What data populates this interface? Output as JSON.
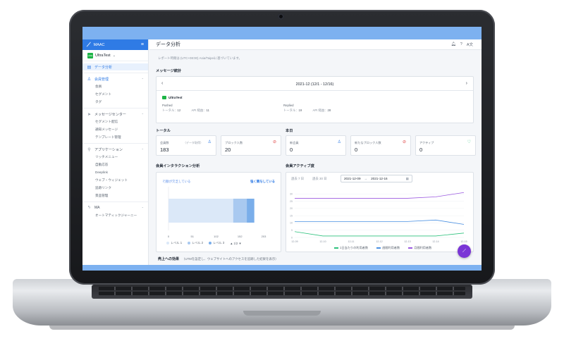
{
  "app": {
    "brand": "MAAC",
    "org": "UltraTest",
    "page_title": "データ分析",
    "line_badge": "LINE"
  },
  "sidebar": {
    "items": [
      {
        "label": "データ分析",
        "icon": "chart-icon",
        "active": true
      },
      {
        "label": "会員管理",
        "icon": "user-icon",
        "group": true
      },
      {
        "label": "会員",
        "sub": true
      },
      {
        "label": "セグメント",
        "sub": true
      },
      {
        "label": "タグ",
        "sub": true
      },
      {
        "label": "メッセージセンター",
        "icon": "send-icon",
        "group": true
      },
      {
        "label": "セグメント配信",
        "sub": true
      },
      {
        "label": "通知メッセージ",
        "sub": true
      },
      {
        "label": "テンプレート管理",
        "sub": true
      },
      {
        "label": "アプリケーション",
        "icon": "rocket-icon",
        "group": true
      },
      {
        "label": "リッチメニュー",
        "sub": true
      },
      {
        "label": "自動応答",
        "sub": true
      },
      {
        "label": "Deeplink",
        "sub": true
      },
      {
        "label": "ウェブ・ウィジェット",
        "sub": true
      },
      {
        "label": "追跡リンク",
        "sub": true
      },
      {
        "label": "景品管理",
        "sub": true
      },
      {
        "label": "MA",
        "icon": "bolt-icon",
        "group": true
      },
      {
        "label": "オートマティックジャーニー",
        "sub": true
      }
    ]
  },
  "main": {
    "timezone_note": "レポート時間は (UTC+08:00) Asia/Taipeiに基づいています。",
    "message_stats": {
      "title": "メッセージ統計",
      "range": "2021-12 (12/1 - 12/16)",
      "account": "UltraTest",
      "pushed": {
        "label": "Pushed",
        "total_label": "トータル：",
        "total": "12",
        "api_label": "API 経由：",
        "api": "11"
      },
      "replied": {
        "label": "Replied",
        "total_label": "トータル：",
        "total": "19",
        "api_label": "API 経由：",
        "api": "28"
      }
    },
    "total": {
      "title": "トータル",
      "cards": [
        {
          "label": "会員数",
          "sub": "（データ取得）",
          "value": "183",
          "icon": "user-icon",
          "color": "#2f7be5"
        },
        {
          "label": "ブロック人数",
          "value": "20",
          "icon": "block-icon",
          "color": "#e04848"
        }
      ]
    },
    "today": {
      "title": "本日",
      "cards": [
        {
          "label": "新会員",
          "value": "0",
          "icon": "user-icon",
          "color": "#2f7be5"
        },
        {
          "label": "新たなブロック人数",
          "value": "0",
          "icon": "block-icon",
          "color": "#e04848"
        },
        {
          "label": "アクティブ",
          "value": "0",
          "icon": "heart-icon",
          "color": "#2ec27e"
        }
      ]
    },
    "interaction": {
      "title": "会員インタラクション分析",
      "left_tag": "行動が欠乏している",
      "right_tag": "強く関与している",
      "legend": [
        "レベル 1",
        "レベル 2",
        "レベル 3"
      ],
      "pager": "1/2",
      "axis_ticks": [
        "0",
        "51",
        "102",
        "152",
        "203"
      ]
    },
    "activity": {
      "title": "会員アクティブ度",
      "btn_7": "過去 7 日",
      "btn_30": "過去 30 日",
      "date_from": "2021-12-09",
      "date_to": "2021-12-16",
      "date_sep": "→",
      "legend": [
        "1日当たりの利用者数",
        "週間利用者数",
        "月間利用者数"
      ]
    },
    "impact": {
      "title": "売上への効果",
      "note": "（UTMを設定し、ウェブサイトへのアクセスを追跡した結果を表示）"
    }
  },
  "chart_data": [
    {
      "type": "bar",
      "title": "会員インタラクション分析",
      "categories": [
        "レベル 1",
        "レベル 2",
        "レベル 3"
      ],
      "series": [
        {
          "name": "レベル 1",
          "values": [
            138
          ]
        },
        {
          "name": "レベル 2",
          "values": [
            29
          ]
        },
        {
          "name": "レベル 3",
          "values": [
            16
          ]
        }
      ],
      "stacked": true,
      "orientation": "horizontal",
      "xlim": [
        0,
        203
      ],
      "xticks": [
        "0",
        "51",
        "102",
        "152",
        "203"
      ],
      "colors": [
        "#dbe8f8",
        "#a9c9f0",
        "#7aaeea"
      ]
    },
    {
      "type": "line",
      "title": "会員アクティブ度",
      "x": [
        "12-09",
        "12-10",
        "12-11",
        "12-12",
        "12-13",
        "12-14",
        "12-15"
      ],
      "xticks": [
        "12-09",
        "12-10",
        "12-11",
        "12-12",
        "12-13",
        "12-14",
        "12-15"
      ],
      "ylim": [
        0,
        35
      ],
      "yticks": [
        "0",
        "5",
        "10",
        "15",
        "20",
        "25",
        "30"
      ],
      "series": [
        {
          "name": "1日当たりの利用者数",
          "values": [
            4,
            1,
            1,
            1,
            1,
            1,
            3
          ],
          "color": "#2ec27e"
        },
        {
          "name": "週間利用者数",
          "values": [
            11,
            11,
            11,
            11,
            11,
            12,
            9
          ],
          "color": "#4a90e2"
        },
        {
          "name": "月間利用者数",
          "values": [
            27,
            27,
            27,
            27,
            27,
            28,
            31
          ],
          "color": "#9b59e0"
        }
      ]
    }
  ]
}
